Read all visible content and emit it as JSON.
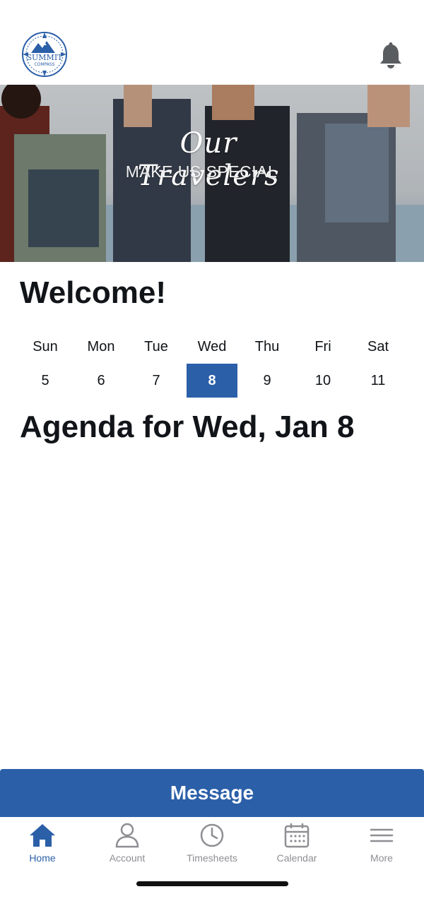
{
  "header": {
    "logo": {
      "icon": "summit-compass-logo-icon",
      "text_top": "SUMMIT",
      "text_bottom": "COMPASS"
    },
    "bell_icon": "bell-icon"
  },
  "hero": {
    "title": "Our Travelers",
    "subtitle": "MAKE US SPECIAL"
  },
  "welcome": "Welcome!",
  "week": {
    "days": [
      {
        "name": "Sun",
        "num": "5"
      },
      {
        "name": "Mon",
        "num": "6"
      },
      {
        "name": "Tue",
        "num": "7"
      },
      {
        "name": "Wed",
        "num": "8"
      },
      {
        "name": "Thu",
        "num": "9"
      },
      {
        "name": "Fri",
        "num": "10"
      },
      {
        "name": "Sat",
        "num": "11"
      }
    ],
    "selected_index": 3
  },
  "agenda_title": "Agenda for Wed, Jan 8",
  "message_button": "Message",
  "tabs": [
    {
      "label": "Home",
      "icon": "home-icon",
      "active": true
    },
    {
      "label": "Account",
      "icon": "user-icon",
      "active": false
    },
    {
      "label": "Timesheets",
      "icon": "clock-icon",
      "active": false
    },
    {
      "label": "Calendar",
      "icon": "calendar-icon",
      "active": false
    },
    {
      "label": "More",
      "icon": "menu-icon",
      "active": false
    }
  ],
  "colors": {
    "accent": "#2b5fa8",
    "text": "#111418",
    "inactive": "#8e8e93"
  }
}
